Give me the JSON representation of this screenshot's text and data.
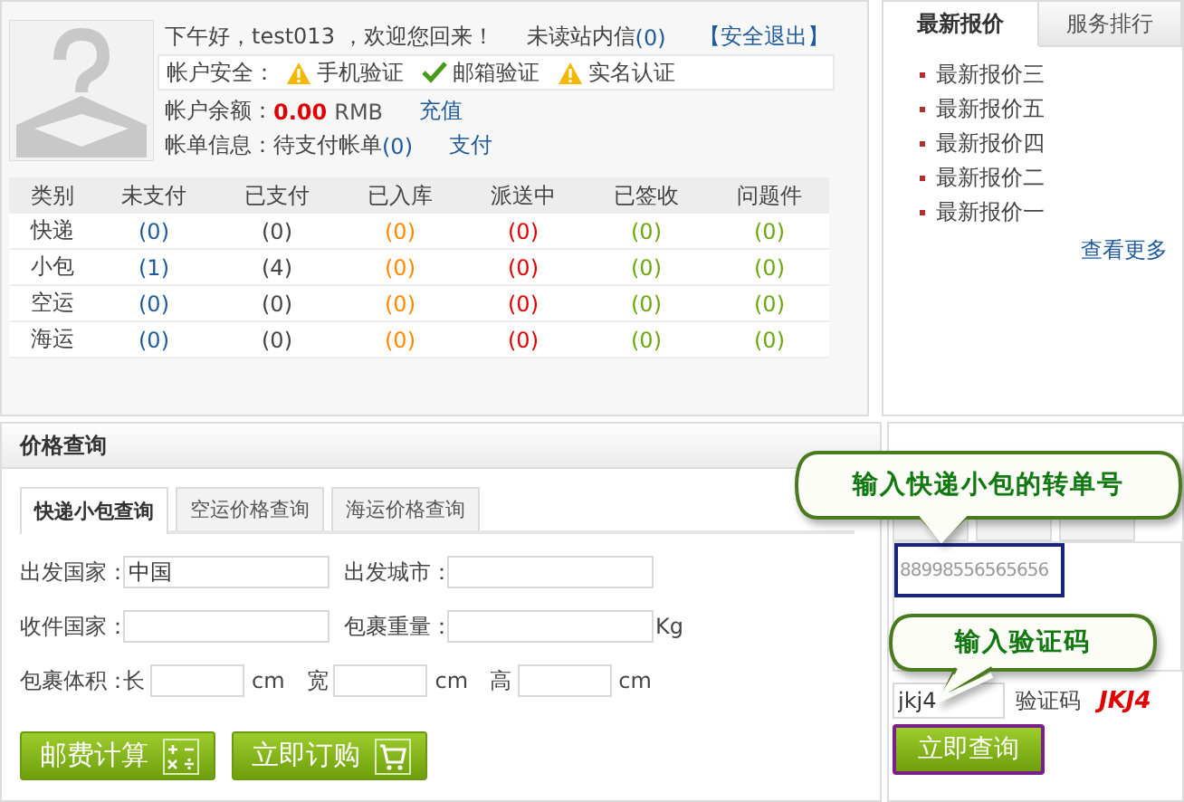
{
  "account": {
    "greeting": "下午好，test013 ，欢迎您回来！",
    "unread_label": "未读站内信",
    "unread_count": "(0)",
    "logout": "【安全退出】",
    "security": {
      "label": "帐户安全：",
      "items": [
        {
          "label": "手机验证",
          "verified": false
        },
        {
          "label": "邮箱验证",
          "verified": true
        },
        {
          "label": "实名认证",
          "verified": false
        }
      ]
    },
    "balance": {
      "label": "帐户余额：",
      "amount": "0.00",
      "unit": "RMB",
      "action": "充值"
    },
    "bills": {
      "label": "帐单信息：待支付帐单",
      "count": "(0)",
      "action": "支付"
    }
  },
  "orders": {
    "category_heading": "类别",
    "columns": [
      {
        "label": "未支付",
        "color": "#1f5b9c"
      },
      {
        "label": "已支付",
        "color": "#444444"
      },
      {
        "label": "已入库",
        "color": "#ff8a00"
      },
      {
        "label": "派送中",
        "color": "#e00000"
      },
      {
        "label": "已签收",
        "color": "#6aaa10"
      },
      {
        "label": "问题件",
        "color": "#6aaa10"
      }
    ],
    "rows": [
      {
        "category": "快递",
        "counts": [
          "(0)",
          "(0)",
          "(0)",
          "(0)",
          "(0)",
          "(0)"
        ]
      },
      {
        "category": "小包",
        "counts": [
          "(1)",
          "(4)",
          "(0)",
          "(0)",
          "(0)",
          "(0)"
        ]
      },
      {
        "category": "空运",
        "counts": [
          "(0)",
          "(0)",
          "(0)",
          "(0)",
          "(0)",
          "(0)"
        ]
      },
      {
        "category": "海运",
        "counts": [
          "(0)",
          "(0)",
          "(0)",
          "(0)",
          "(0)",
          "(0)"
        ]
      }
    ]
  },
  "news": {
    "tabs": [
      {
        "label": "最新报价",
        "selected": true
      },
      {
        "label": "服务排行",
        "selected": false
      }
    ],
    "items": [
      "最新报价三",
      "最新报价五",
      "最新报价四",
      "最新报价二",
      "最新报价一"
    ],
    "more": "查看更多"
  },
  "price_query": {
    "title": "价格查询",
    "tabs": [
      {
        "label": "快递小包查询",
        "selected": true
      },
      {
        "label": "空运价格查询",
        "selected": false
      },
      {
        "label": "海运价格查询",
        "selected": false
      }
    ],
    "fields": [
      {
        "label": "出发国家：",
        "value": "中国"
      },
      {
        "label": "出发城市："
      },
      {
        "label": "收件国家："
      },
      {
        "label": "包裹重量：",
        "unit": "Kg"
      }
    ],
    "volume": {
      "label": "包裹体积：",
      "dims": [
        {
          "label": "长",
          "unit": "cm"
        },
        {
          "label": "宽",
          "unit": "cm"
        },
        {
          "label": "高",
          "unit": "cm"
        }
      ]
    },
    "buttons": [
      {
        "label": "邮费计算",
        "kind": "calculator"
      },
      {
        "label": "立即订购",
        "kind": "cart"
      }
    ]
  },
  "tracking": {
    "number_placeholder": "88998556565656",
    "captcha_value": "jkj4",
    "captcha_label": "验证码",
    "captcha_code": "JKJ4",
    "submit": "立即查询"
  },
  "callouts": [
    {
      "text": "输入快递小包的转单号"
    },
    {
      "text": "输入验证码"
    }
  ]
}
